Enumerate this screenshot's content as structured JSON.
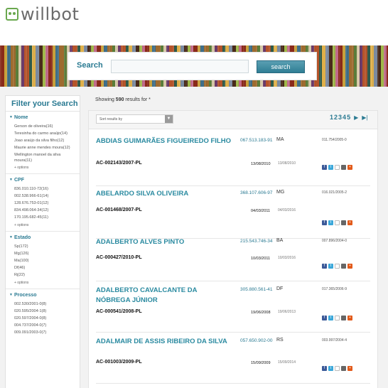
{
  "brand": {
    "name": "willbot"
  },
  "search": {
    "label": "Search",
    "value": "",
    "button": "search"
  },
  "sidebar": {
    "title": "Filter your Search",
    "facets": [
      {
        "title": "Nome",
        "items": [
          "Gerson de oliveira(16)",
          "Teresinha do carmo araújo(14)",
          "Joao araújo da silva filho(12)",
          "Maurie anne mendes moura(12)",
          "Wellington manoel da silva moura(11)"
        ],
        "more": "+ options"
      },
      {
        "title": "CPF",
        "items": [
          "836.010.110-72(16)",
          "002.538.966-61(14)",
          "128.676.753-01(12)",
          "834.498.064-34(12)",
          "170.195.682-45(11)"
        ],
        "more": "+ options"
      },
      {
        "title": "Estado",
        "items": [
          "Sp(172)",
          "Mg(126)",
          "Ma(100)",
          "Df(46)",
          "Rj(22)"
        ],
        "more": "+ options"
      },
      {
        "title": "Processo",
        "items": [
          "002.530/2001-0(8)",
          "020.595/2004-1(8)",
          "020.597/2004-0(8)",
          "004.737/2004-0(7)",
          "009.091/2003-0(7)"
        ],
        "more": ""
      }
    ]
  },
  "results_header": {
    "prefix": "Showing ",
    "count": "590",
    "suffix": " results for *"
  },
  "toolbar": {
    "sort_label": "Sort results by",
    "sort_arrow": "▼",
    "pages": [
      "1",
      "2",
      "3",
      "4",
      "5"
    ],
    "next": "▶",
    "last": "▶|"
  },
  "results": [
    {
      "name": "ABDIAS GUIMARÃES FIGUEIREDO FILHO",
      "code": "AC-002143/2007-PL",
      "cpf": "067.513.183-91",
      "uf": "MA",
      "date1": "13/08/2010",
      "date2": "13/08/2010",
      "process": "011.754/2005-0"
    },
    {
      "name": "ABELARDO SILVA OLIVEIRA",
      "code": "AC-001468/2007-PL",
      "cpf": "368.107.606-97",
      "uf": "MG",
      "date1": "04/03/2011",
      "date2": "04/03/2016",
      "process": "016.021/2005-2"
    },
    {
      "name": "ADALBERTO ALVES PINTO",
      "code": "AC-000427/2010-PL",
      "cpf": "215.543.746-34",
      "uf": "BA",
      "date1": "10/03/2011",
      "date2": "10/03/2016",
      "process": "007.896/2004-0"
    },
    {
      "name": "ADALBERTO CAVALCANTE DA NÓBREGA JÚNIOR",
      "code": "AC-000541/2008-PL",
      "cpf": "305.880.561-41",
      "uf": "DF",
      "date1": "19/06/2008",
      "date2": "19/06/2013",
      "process": "017.365/2006-9"
    },
    {
      "name": "ADALMAIR DE ASSIS RIBEIRO DA SILVA",
      "code": "AC-001003/2009-PL",
      "cpf": "057.650.902-00",
      "uf": "RS",
      "date1": "15/09/2009",
      "date2": "15/09/2014",
      "process": "003.997/2004-4"
    }
  ],
  "share_icons": [
    "facebook-icon",
    "twitter-icon",
    "email-icon",
    "print-icon",
    "plus-icon"
  ]
}
